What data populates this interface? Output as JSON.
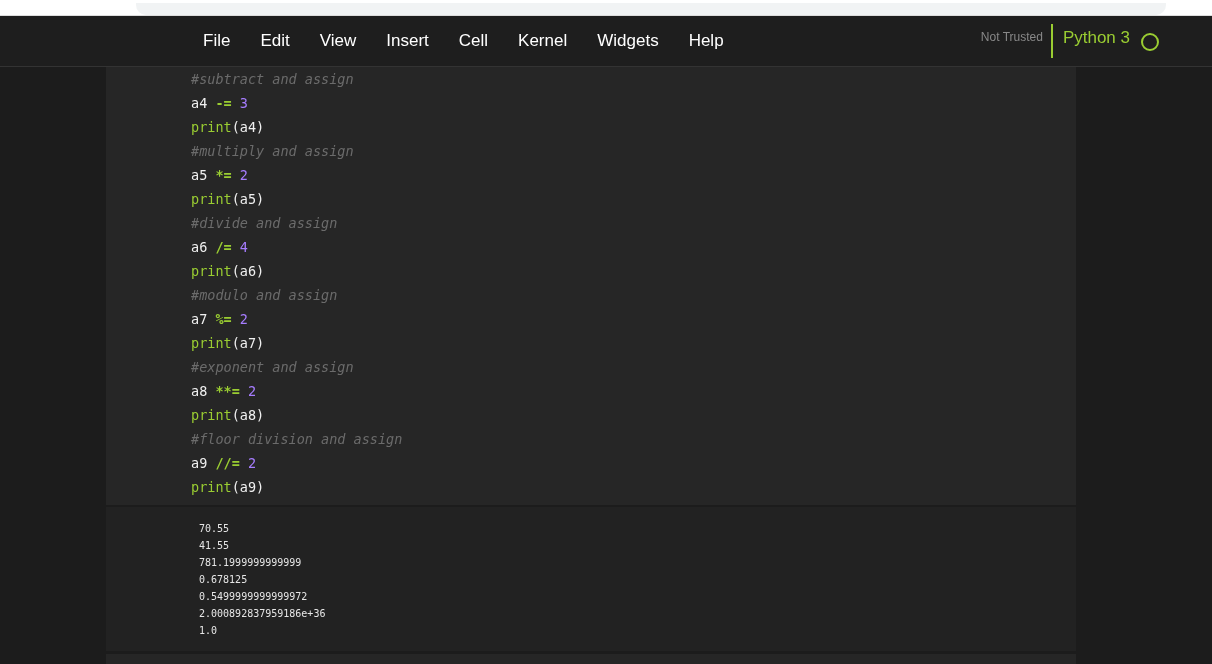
{
  "menu": [
    {
      "label": "File"
    },
    {
      "label": "Edit"
    },
    {
      "label": "View"
    },
    {
      "label": "Insert"
    },
    {
      "label": "Cell"
    },
    {
      "label": "Kernel"
    },
    {
      "label": "Widgets"
    },
    {
      "label": "Help"
    }
  ],
  "trust": "Not Trusted",
  "kernel": {
    "name": "Python 3",
    "busy": false
  },
  "code": [
    [
      {
        "kind": "comment",
        "text": "#subtract and assign"
      }
    ],
    [
      {
        "kind": "name",
        "text": "a4 "
      },
      {
        "kind": "op",
        "text": "-="
      },
      {
        "kind": "num",
        "text": " 3"
      }
    ],
    [
      {
        "kind": "builtin",
        "text": "print"
      },
      {
        "kind": "name",
        "text": "(a4)"
      }
    ],
    [
      {
        "kind": "comment",
        "text": "#multiply and assign"
      }
    ],
    [
      {
        "kind": "name",
        "text": "a5 "
      },
      {
        "kind": "op",
        "text": "*="
      },
      {
        "kind": "num",
        "text": " 2"
      }
    ],
    [
      {
        "kind": "builtin",
        "text": "print"
      },
      {
        "kind": "name",
        "text": "(a5)"
      }
    ],
    [
      {
        "kind": "comment",
        "text": "#divide and assign"
      }
    ],
    [
      {
        "kind": "name",
        "text": "a6 "
      },
      {
        "kind": "op",
        "text": "/="
      },
      {
        "kind": "num",
        "text": " 4"
      }
    ],
    [
      {
        "kind": "builtin",
        "text": "print"
      },
      {
        "kind": "name",
        "text": "(a6)"
      }
    ],
    [
      {
        "kind": "comment",
        "text": "#modulo and assign"
      }
    ],
    [
      {
        "kind": "name",
        "text": "a7 "
      },
      {
        "kind": "op",
        "text": "%="
      },
      {
        "kind": "num",
        "text": " 2"
      }
    ],
    [
      {
        "kind": "builtin",
        "text": "print"
      },
      {
        "kind": "name",
        "text": "(a7)"
      }
    ],
    [
      {
        "kind": "comment",
        "text": "#exponent and assign"
      }
    ],
    [
      {
        "kind": "name",
        "text": "a8 "
      },
      {
        "kind": "op",
        "text": "**="
      },
      {
        "kind": "num",
        "text": " 2"
      }
    ],
    [
      {
        "kind": "builtin",
        "text": "print"
      },
      {
        "kind": "name",
        "text": "(a8)"
      }
    ],
    [
      {
        "kind": "comment",
        "text": "#floor division and assign"
      }
    ],
    [
      {
        "kind": "name",
        "text": "a9 "
      },
      {
        "kind": "op",
        "text": "//="
      },
      {
        "kind": "num",
        "text": " 2"
      }
    ],
    [
      {
        "kind": "builtin",
        "text": "print"
      },
      {
        "kind": "name",
        "text": "(a9)"
      }
    ]
  ],
  "output": [
    "70.55",
    "41.55",
    "781.1999999999999",
    "0.678125",
    "0.5499999999999972",
    "2.000892837959186e+36",
    "1.0"
  ]
}
